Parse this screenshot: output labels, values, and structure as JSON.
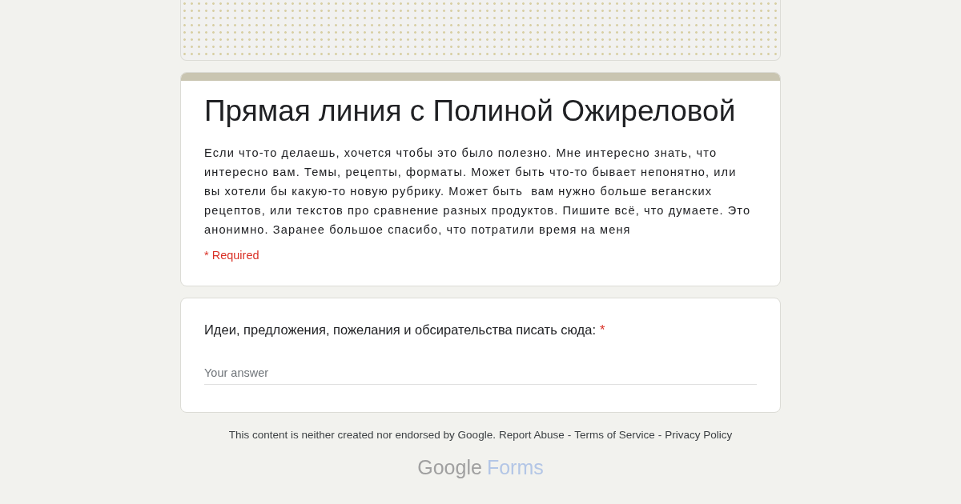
{
  "form": {
    "title": "Прямая линия с Полиной Ожиреловой",
    "description": "Если что-то делаешь, хочется чтобы это было полезно. Мне интересно знать, что интересно вам. Темы, рецепты, форматы. Может быть что-то бывает непонятно, или вы хотели бы какую-то новую рубрику. Может быть  вам нужно больше веганских рецептов, или текстов про сравнение разных продуктов. Пишите всё, что думаете. Это анонимно. Заранее большое спасибо, что потратили время на меня",
    "required_note": "* Required"
  },
  "questions": [
    {
      "label": "Идеи, предложения, пожелания и обсирательства писать сюда:",
      "required": true,
      "required_mark": "*",
      "placeholder": "Your answer"
    }
  ],
  "footer": {
    "disclaimer": "This content is neither created nor endorsed by Google.",
    "links": [
      "Report Abuse",
      "Terms of Service",
      "Privacy Policy"
    ],
    "separator": "-"
  },
  "logo": {
    "brand": "Google",
    "product": "Forms"
  }
}
